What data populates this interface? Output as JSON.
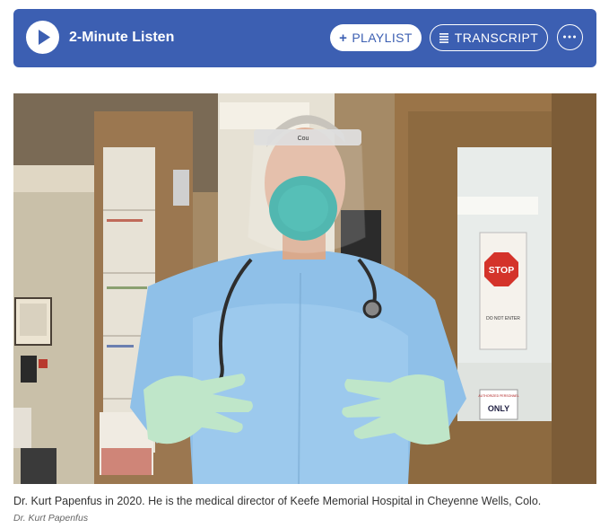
{
  "player": {
    "title": "2-Minute Listen",
    "playlist_label": "PLAYLIST",
    "transcript_label": "TRANSCRIPT",
    "icons": {
      "play": "play-icon",
      "playlist": "plus-icon",
      "transcript": "transcript-lines-icon",
      "more": "more-options-icon"
    },
    "colors": {
      "bar": "#3c5fb2",
      "button_bg": "#ffffff"
    }
  },
  "image": {
    "signs": {
      "stop": "STOP",
      "do_not_enter": "DO NOT ENTER",
      "authorized_line1": "AUTHORIZED PERSONNEL",
      "authorized_line2": "ONLY",
      "face_shield_brand": "Cou"
    }
  },
  "caption": {
    "text": "Dr. Kurt Papenfus in 2020. He is the medical director of Keefe Memorial Hospital in Cheyenne Wells, Colo.",
    "credit": "Dr. Kurt Papenfus"
  }
}
